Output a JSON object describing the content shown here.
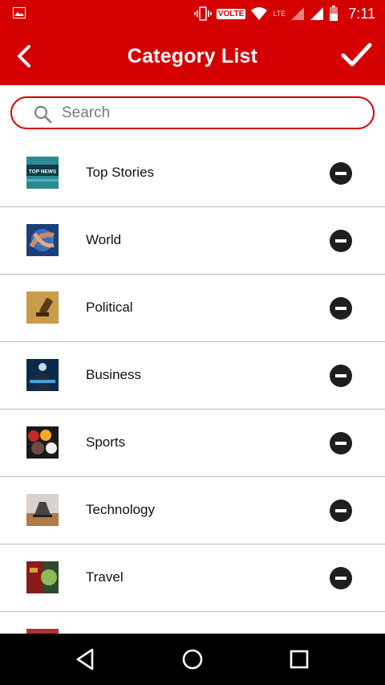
{
  "status_bar": {
    "volte_label": "VOLTE",
    "lte_label": "LTE",
    "time": "7:11"
  },
  "app_bar": {
    "title": "Category List"
  },
  "search": {
    "placeholder": "Search",
    "value": ""
  },
  "categories": [
    {
      "label": "Top Stories",
      "thumb_text": "TOP NEWS"
    },
    {
      "label": "World"
    },
    {
      "label": "Political"
    },
    {
      "label": "Business"
    },
    {
      "label": "Sports"
    },
    {
      "label": "Technology"
    },
    {
      "label": "Travel"
    }
  ],
  "colors": {
    "accent": "#d50000",
    "divider": "#bdbdbd",
    "nav_background": "#000000"
  }
}
